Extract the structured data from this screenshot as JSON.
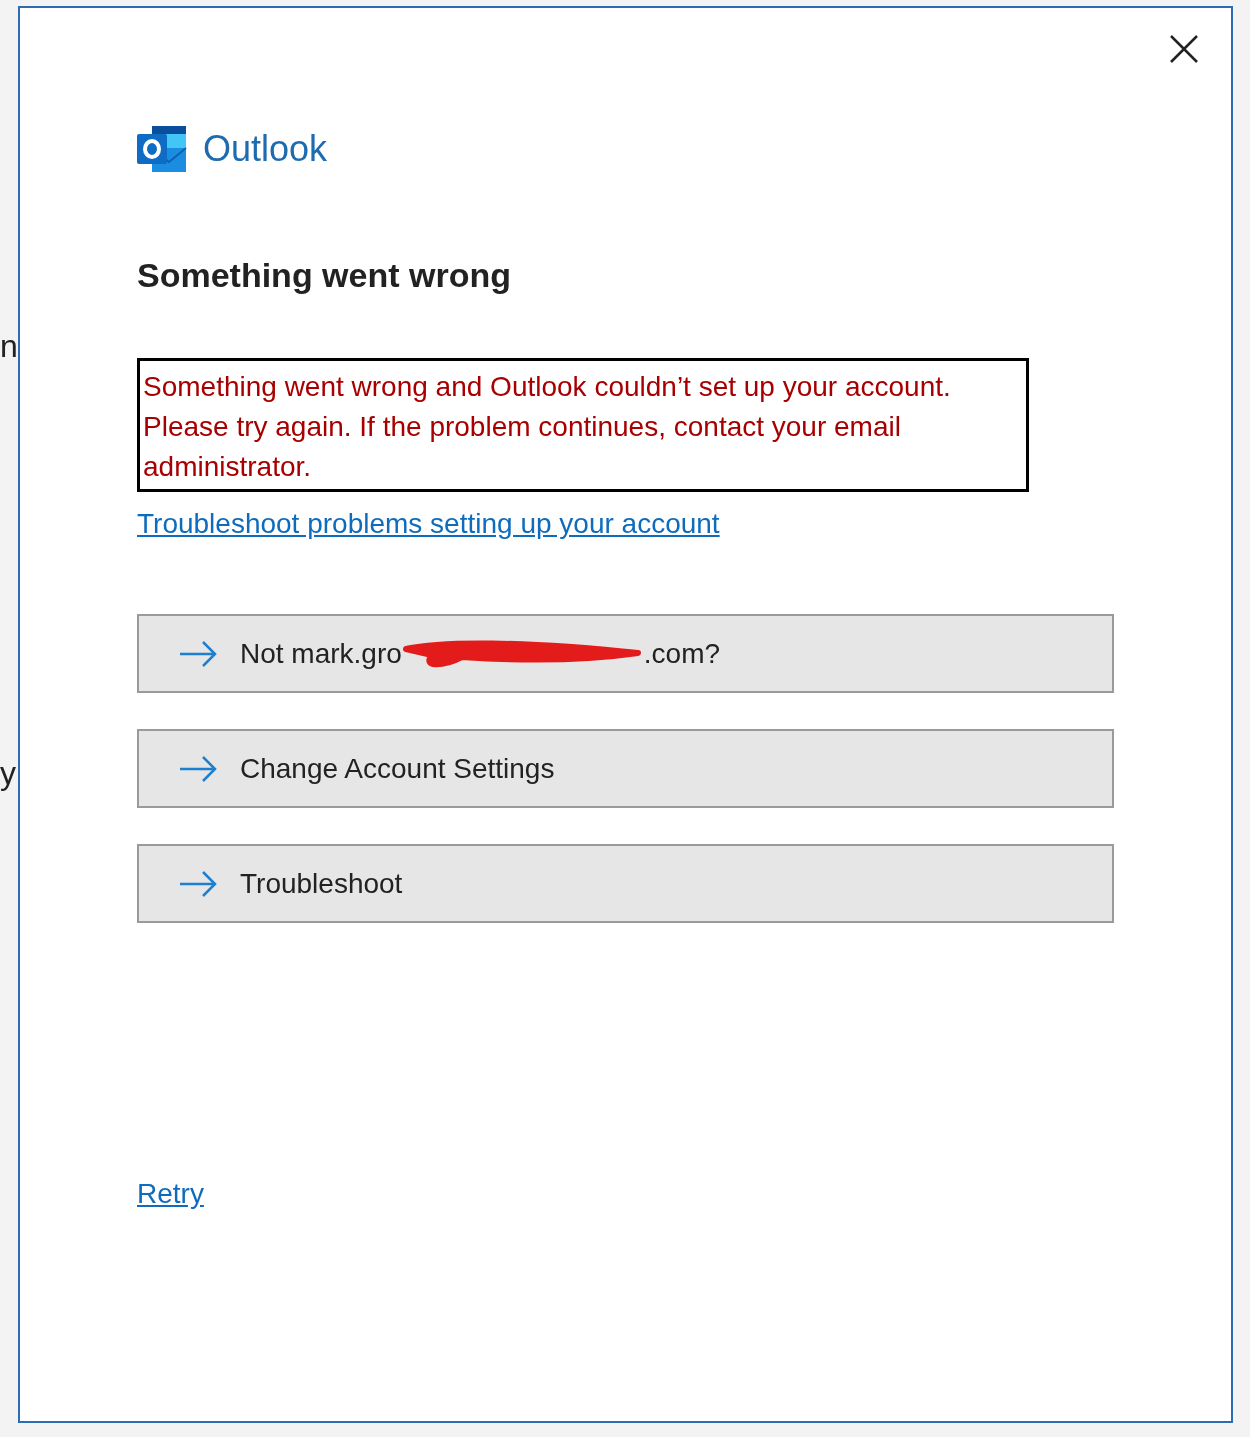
{
  "background_window": {
    "fragments": [
      "n",
      "y"
    ]
  },
  "dialog": {
    "app_name": "Outlook",
    "heading": "Something went wrong",
    "error_message": "Something went wrong and Outlook couldn’t set up your account. Please try again. If the problem continues, contact your email administrator.",
    "help_link": "Troubleshoot problems setting up your account",
    "options": [
      {
        "kind": "redacted",
        "label_start": "Not mark.gro",
        "label_end": ".com?"
      },
      {
        "kind": "plain",
        "label": "Change Account Settings"
      },
      {
        "kind": "plain",
        "label": "Troubleshoot"
      }
    ],
    "retry_link": "Retry"
  }
}
